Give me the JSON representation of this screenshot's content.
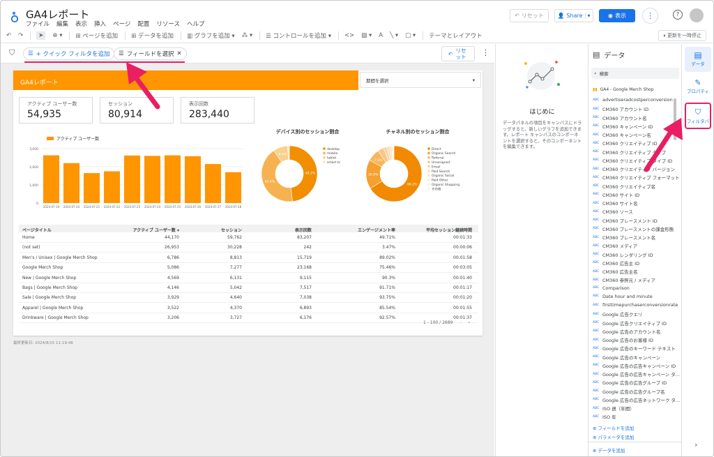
{
  "header": {
    "title": "GA4レポート",
    "menus": [
      "ファイル",
      "編集",
      "表示",
      "挿入",
      "ページ",
      "配置",
      "リソース",
      "ヘルプ"
    ],
    "reset": "リセット",
    "share": "Share",
    "view": "表示"
  },
  "toolbar": {
    "items": [
      "ページを追加",
      "データを追加",
      "グラフを追加",
      "コントロールを追加",
      "テーマとレイアウト"
    ],
    "pause": "更新を一時停止"
  },
  "filterbar": {
    "quick": "+ クイック フィルタを追加",
    "field": "フィールドを選択",
    "reset": "リセット"
  },
  "report": {
    "title": "GA4レポート",
    "period": "期間を選択",
    "footer": "最終更新日: 2024/8/15 11:19:48",
    "kpis": [
      {
        "label": "アクティブ ユーザー数",
        "value": "54,935"
      },
      {
        "label": "セッション",
        "value": "80,914"
      },
      {
        "label": "表示回数",
        "value": "283,440"
      }
    ]
  },
  "chart_data": [
    {
      "type": "bar",
      "series": [
        {
          "name": "アクティブ ユーザー数",
          "values": [
            2630,
            2200,
            1650,
            1750,
            2620,
            2600,
            2630,
            2580,
            2150,
            1700
          ]
        }
      ],
      "categories": [
        "2024-07-19",
        "2024-07-20",
        "2024-07-21",
        "2024-07-22",
        "2024-07-23",
        "2024-07-24",
        "2024-07-25",
        "2024-07-26",
        "2024-07-27",
        "2024-07-28"
      ],
      "yticks": [
        "0",
        "1,000",
        "2,000",
        "3,000"
      ],
      "ylim": [
        0,
        3000
      ]
    },
    {
      "type": "pie",
      "title": "デバイス別のセッション割合",
      "slices": [
        {
          "name": "desktop",
          "value": 48.2
        },
        {
          "name": "mobile",
          "value": 42.4
        },
        {
          "name": "tablet",
          "value": 8.4
        },
        {
          "name": "smart tv",
          "value": 1.0
        }
      ],
      "labels": [
        "48.2%",
        "42.4%",
        "8.4%"
      ]
    },
    {
      "type": "pie",
      "title": "チャネル別のセッション割合",
      "slices": [
        {
          "name": "Direct",
          "value": 66.2
        },
        {
          "name": "Organic Search",
          "value": 16.9
        },
        {
          "name": "Referral",
          "value": 7.2
        },
        {
          "name": "Unassigned",
          "value": 3.5
        },
        {
          "name": "Email",
          "value": 2.0
        },
        {
          "name": "Paid Search",
          "value": 1.6
        },
        {
          "name": "Organic Social",
          "value": 1.2
        },
        {
          "name": "Paid Other",
          "value": 0.8
        },
        {
          "name": "Organic Shopping",
          "value": 0.4
        },
        {
          "name": "その他",
          "value": 0.2
        }
      ],
      "labels": [
        "66.2%",
        "16.9%",
        "7.2%"
      ]
    }
  ],
  "table": {
    "headers": [
      "ページタイトル",
      "アクティブ ユーザー数 ▾",
      "セッション",
      "表示回数",
      "エンゲージメント率",
      "平均セッション継続時間"
    ],
    "rows": [
      [
        "Home",
        "44,170",
        "59,762",
        "83,207",
        "49.71%",
        "00:01:33"
      ],
      [
        "(not set)",
        "26,953",
        "30,228",
        "242",
        "3.47%",
        "00:00:06"
      ],
      [
        "Men's / Unisex | Google Merch Shop",
        "6,786",
        "8,813",
        "15,719",
        "89.02%",
        "00:01:58"
      ],
      [
        "Google Merch Shop",
        "5,086",
        "7,277",
        "23,168",
        "75.46%",
        "00:03:05"
      ],
      [
        "New | Google Merch Shop",
        "4,569",
        "6,131",
        "9,115",
        "90.3%",
        "00:01:40"
      ],
      [
        "Bags | Google Merch Shop",
        "4,146",
        "5,042",
        "7,517",
        "91.71%",
        "00:01:17"
      ],
      [
        "Sale | Google Merch Shop",
        "3,929",
        "4,640",
        "7,038",
        "93.75%",
        "00:01:20"
      ],
      [
        "Apparel | Google Merch Shop",
        "3,522",
        "4,370",
        "6,893",
        "85.54%",
        "00:01:55"
      ],
      [
        "Drinkware | Google Merch Shop",
        "3,206",
        "3,727",
        "6,176",
        "92.57%",
        "00:01:37"
      ]
    ],
    "pagination": "1 - 100 / 2689"
  },
  "welcome": {
    "title": "はじめに",
    "text": "データパネルの項目をキャンバスにドラッグすると、新しいグラフを追加できます。レポート キャンバスのコンポーネントを選択すると、そのコンポーネントを編集できます。"
  },
  "datapanel": {
    "title": "データ",
    "search": "検索",
    "source": "GA4 - Google Merch Shop",
    "fields": [
      "advertiseradcostperconversion",
      "CM360 アカウント ID",
      "CM360 アカウント名",
      "CM360 キャンペーン ID",
      "CM360 キャンペーン名",
      "CM360 クリエイティブ ID",
      "CM360 クリエイティブ タイプ",
      "CM360 クリエイティブ タイプ ID",
      "CM360 クリエイティブ バージョン",
      "CM360 クリエイティブ フォーマット",
      "CM360 クリエイティブ名",
      "CM360 サイト ID",
      "CM360 サイト名",
      "CM360 ソース",
      "CM360 プレースメント ID",
      "CM360 プレースメントの課金形態",
      "CM360 プレースメント名",
      "CM360 メディア",
      "CM360 レンダリング ID",
      "CM360 広告主 ID",
      "CM360 広告主名",
      "CM360 参照元 / メディア",
      "Comparison",
      "Date hour and minute",
      "firsttimepurchaserconversionrate",
      "Google 広告クエリ",
      "Google 広告クリエイティブ ID",
      "Google 広告のアカウント名",
      "Google 広告のお客様 ID",
      "Google 広告のキーワード テキスト",
      "Google 広告のキャンペーン",
      "Google 広告の広告キャンペーン ID",
      "Google 広告の広告キャンペーン タ...",
      "Google 広告の広告グループ ID",
      "Google 広告の広告グループ名",
      "Google 広告の広告ネットワーク タ...",
      "ISO 週（年間）",
      "ISO 年"
    ],
    "add_field": "フィールドを追加",
    "add_param": "パラメータを追加",
    "add_data": "データを追加"
  },
  "rail": {
    "data": "データ",
    "props": "プロパティ",
    "filter": "フィルタバー"
  }
}
